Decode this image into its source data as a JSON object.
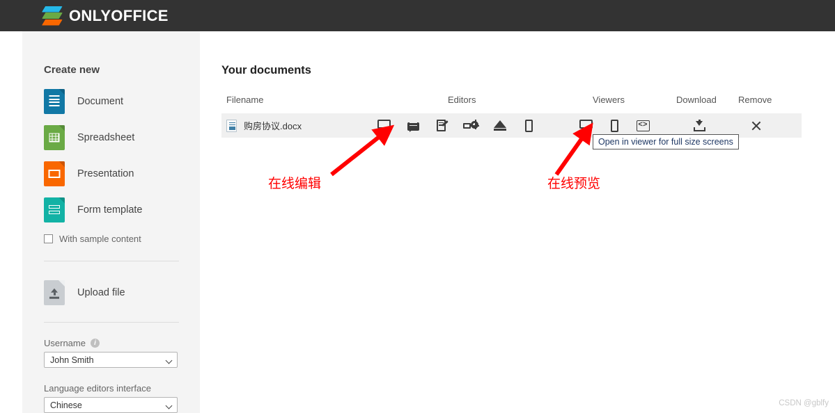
{
  "header": {
    "brand": "ONLYOFFICE",
    "logo_colors": {
      "top": "#25b8e8",
      "middle": "#6aaa45",
      "bottom": "#f96700"
    },
    "background": "#333333"
  },
  "sidebar": {
    "create_new_title": "Create new",
    "items": [
      {
        "label": "Document",
        "icon": "document-icon",
        "color": "#1178a5"
      },
      {
        "label": "Spreadsheet",
        "icon": "spreadsheet-icon",
        "color": "#6aaa45"
      },
      {
        "label": "Presentation",
        "icon": "presentation-icon",
        "color": "#f96700"
      },
      {
        "label": "Form template",
        "icon": "form-template-icon",
        "color": "#12b2a5"
      }
    ],
    "sample_content": {
      "label": "With sample content",
      "checked": false
    },
    "upload": {
      "label": "Upload file",
      "icon": "upload-file-icon"
    },
    "username": {
      "label": "Username",
      "info_icon": "info-icon",
      "value": "John Smith"
    },
    "language": {
      "label": "Language editors interface",
      "value": "Chinese"
    }
  },
  "main": {
    "title": "Your documents",
    "columns": [
      "Filename",
      "Editors",
      "Viewers",
      "Download",
      "Remove"
    ],
    "row": {
      "filename": "购房协议.docx",
      "file_icon": "docx-file-icon",
      "editors": [
        {
          "icon": "monitor-icon"
        },
        {
          "icon": "comment-bubble-icon"
        },
        {
          "icon": "edit-document-icon"
        },
        {
          "icon": "form-settings-icon"
        },
        {
          "icon": "draw-icon"
        },
        {
          "icon": "mobile-phone-icon"
        }
      ],
      "viewers": [
        {
          "icon": "monitor-icon"
        },
        {
          "icon": "mobile-phone-icon"
        },
        {
          "icon": "embed-code-icon"
        }
      ],
      "download": {
        "icon": "download-icon"
      },
      "remove": {
        "icon": "close-x-icon"
      }
    },
    "tooltip": "Open in viewer for full size screens"
  },
  "annotations": {
    "color": "#ff0000",
    "editing_label": "在线编辑",
    "preview_label": "在线预览"
  },
  "watermark": "CSDN @gblfy"
}
